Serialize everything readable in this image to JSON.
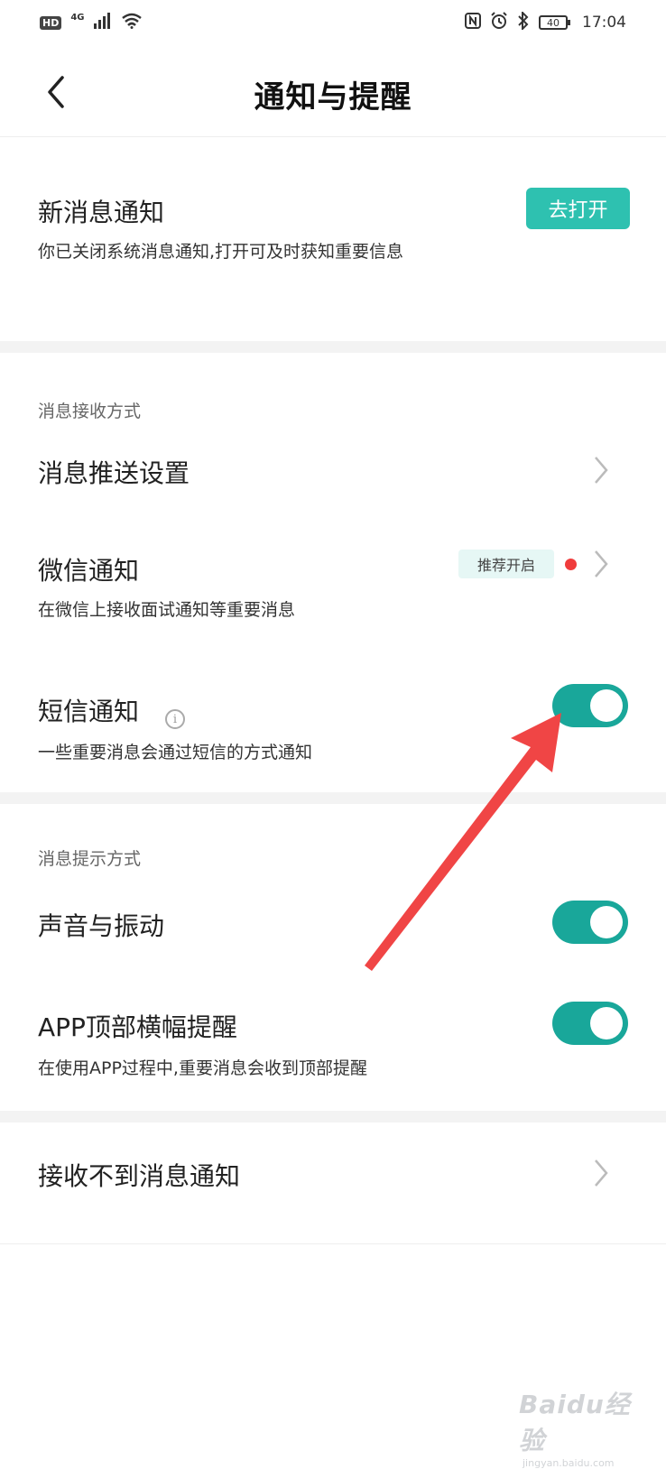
{
  "status_bar": {
    "hd": "HD",
    "network": "4G",
    "battery": "40",
    "time": "17:04"
  },
  "header": {
    "title": "通知与提醒"
  },
  "new_message": {
    "title": "新消息通知",
    "desc": "你已关闭系统消息通知,打开可及时获知重要信息",
    "button": "去打开"
  },
  "receive_group": {
    "label": "消息接收方式",
    "push_settings": "消息推送设置",
    "wechat": {
      "title": "微信通知",
      "desc": "在微信上接收面试通知等重要消息",
      "tag": "推荐开启"
    },
    "sms": {
      "title": "短信通知",
      "desc": "一些重要消息会通过短信的方式通知",
      "enabled": true
    }
  },
  "prompt_group": {
    "label": "消息提示方式",
    "sound": {
      "title": "声音与振动",
      "enabled": true
    },
    "banner": {
      "title": "APP顶部横幅提醒",
      "desc": "在使用APP过程中,重要消息会收到顶部提醒",
      "enabled": true
    }
  },
  "help": {
    "title": "接收不到消息通知"
  },
  "watermark": {
    "brand": "Baidu经验",
    "url": "jingyan.baidu.com"
  },
  "colors": {
    "accent": "#19a79a",
    "button": "#2ec1b0",
    "arrow": "#f04545",
    "dot": "#f03c3c"
  }
}
